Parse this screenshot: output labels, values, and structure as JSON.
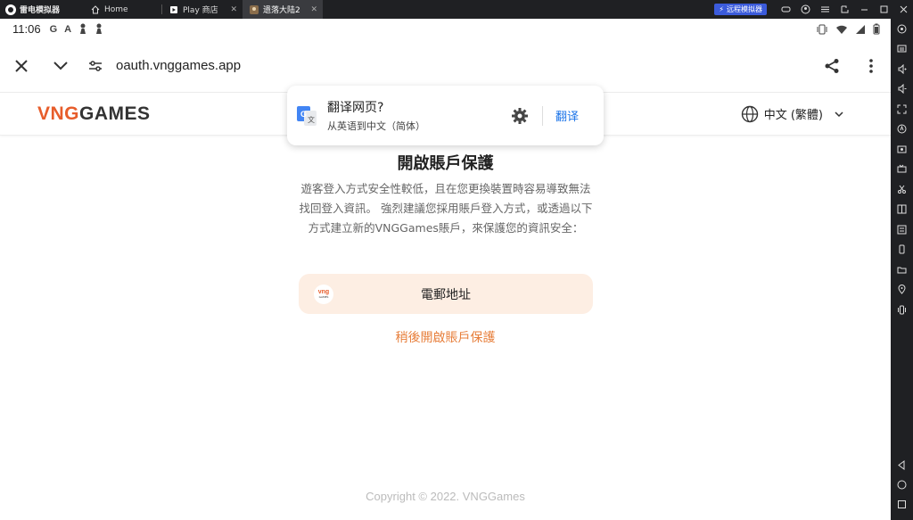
{
  "emulator": {
    "app_name": "雷电模拟器",
    "tabs": [
      {
        "label": "Home"
      },
      {
        "label": "Play 商店"
      },
      {
        "label": "遗落大陆2"
      }
    ],
    "remote_label": "远程模拟器"
  },
  "status_bar": {
    "time": "11:06",
    "left_icons": [
      "G",
      "A"
    ]
  },
  "url_bar": {
    "url": "oauth.vnggames.app"
  },
  "site_header": {
    "brand_vng": "VNG",
    "brand_games": "GAMES",
    "language": "中文 (繁體)"
  },
  "translate_popup": {
    "title": "翻译网页?",
    "subtitle": "从英语到中文（简体）",
    "action": "翻译"
  },
  "main": {
    "title": "開啟賬戶保護",
    "description": "遊客登入方式安全性較低，且在您更換裝置時容易導致無法找回登入資訊。 強烈建議您採用賬戶登入方式，或透過以下方式建立新的VNGGames賬戶，來保護您的資訊安全：",
    "email_button": "電郵地址",
    "email_logo_top": "vng",
    "email_logo_bottom": "GAMES",
    "later_link": "稍後開啟賬戶保護",
    "copyright": "Copyright © 2022. VNGGames"
  },
  "colors": {
    "brand_orange": "#e75d2b",
    "link_orange": "#e77e3a",
    "button_bg": "#fdeee3",
    "translate_blue": "#1a73e8"
  }
}
